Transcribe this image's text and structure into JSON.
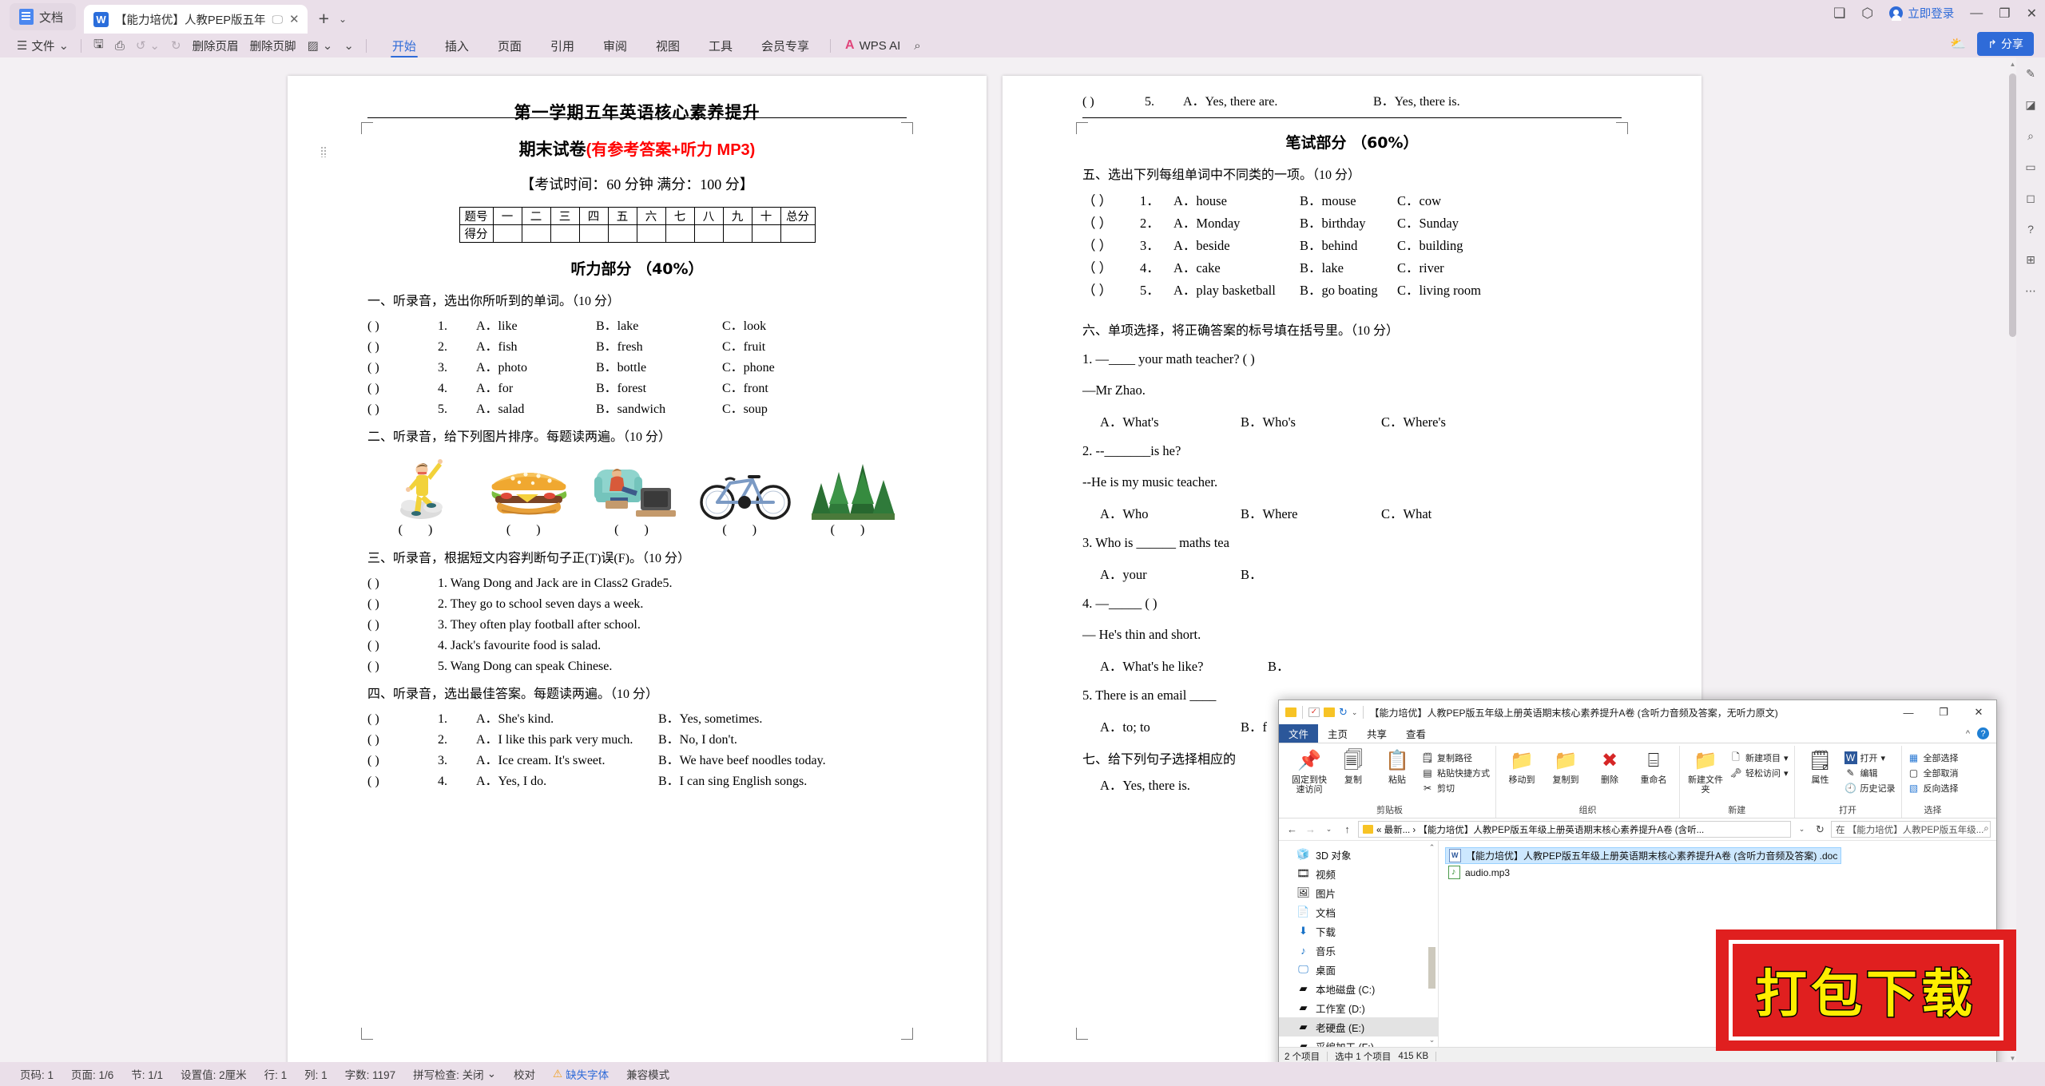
{
  "window": {
    "doc_chip_label": "文档",
    "tab_label": "【能力培优】人教PEP版五年",
    "tab_close": "✕",
    "add_tab": "+",
    "tab_caret": "⌄",
    "login_label": "立即登录",
    "minimize": "—",
    "maximize": "❐",
    "close": "✕",
    "icon_a": "❏",
    "icon_b": "⬡",
    "share_label": "分享",
    "cloud_icon": "cloud-upload-icon"
  },
  "toolbar": {
    "file_menu": "文件",
    "file_caret": "⌄",
    "quick": [
      {
        "icon": "save-icon",
        "glyph": "🖫"
      },
      {
        "icon": "print-icon",
        "glyph": "⎙"
      },
      {
        "icon": "undo-icon",
        "glyph": "↺"
      },
      {
        "icon": "undo-caret",
        "glyph": "⌄"
      },
      {
        "icon": "redo-icon",
        "glyph": "↻"
      }
    ],
    "del_header": "删除页眉",
    "del_footer": "删除页脚",
    "style_caret": "⌄",
    "more_caret": "⌄",
    "menus": [
      {
        "label": "开始",
        "active": true
      },
      {
        "label": "插入",
        "active": false
      },
      {
        "label": "页面",
        "active": false
      },
      {
        "label": "引用",
        "active": false
      },
      {
        "label": "审阅",
        "active": false
      },
      {
        "label": "视图",
        "active": false
      },
      {
        "label": "工具",
        "active": false
      },
      {
        "label": "会员专享",
        "active": false
      }
    ],
    "wps_ai": "WPS AI",
    "search_icon": "search-icon"
  },
  "document": {
    "title1": "第一学期五年英语核心素养提升",
    "title2_black": "期末试卷",
    "title2_red": "(有参考答案+听力 MP3)",
    "title3": "【考试时间：60 分钟 满分：100 分】",
    "score_table": {
      "row1_label": "题号",
      "row1_cells": [
        "一",
        "二",
        "三",
        "四",
        "五",
        "六",
        "七",
        "八",
        "九",
        "十"
      ],
      "row1_total": "总分",
      "row2_label": "得分"
    },
    "listening_section": "听力部分 （40%）",
    "q1": {
      "head": "一、听录音，选出你所听到的单词。（10 分）",
      "rows": [
        {
          "paren": "(            )",
          "num": "1.",
          "a": "A．like",
          "b": "B．lake",
          "c": "C．look"
        },
        {
          "paren": "(            )",
          "num": "2.",
          "a": "A．fish",
          "b": "B．fresh",
          "c": "C．fruit"
        },
        {
          "paren": "(            )",
          "num": "3.",
          "a": "A．photo",
          "b": "B．bottle",
          "c": "C．phone"
        },
        {
          "paren": "(            )",
          "num": "4.",
          "a": "A．for",
          "b": "B．forest",
          "c": "C．front"
        },
        {
          "paren": "(            )",
          "num": "5.",
          "a": "A．salad",
          "b": "B．sandwich",
          "c": "C．soup"
        }
      ]
    },
    "q2": {
      "head": "二、听录音，给下列图片排序。每题读两遍。（10 分）",
      "pictures": [
        "kungfu-boy-image",
        "hamburger-image",
        "watching-tv-image",
        "bicycle-image",
        "forest-image"
      ],
      "answer_blanks": [
        "(        )",
        "(        )",
        "(        )",
        "(        )",
        "(        )"
      ]
    },
    "q3": {
      "head": "三、听录音，根据短文内容判断句子正(T)误(F)。（10 分）",
      "rows": [
        {
          "paren": "(            )",
          "text": "1. Wang Dong and Jack are in Class2 Grade5."
        },
        {
          "paren": "(            )",
          "text": "2. They go to school seven days a week."
        },
        {
          "paren": "(            )",
          "text": "3. They often play football after school."
        },
        {
          "paren": "(            )",
          "text": "4. Jack's favourite food is salad."
        },
        {
          "paren": "(            )",
          "text": "5. Wang Dong can speak Chinese."
        }
      ]
    },
    "q4": {
      "head": "四、听录音，选出最佳答案。每题读两遍。（10 分）",
      "rows": [
        {
          "paren": "(        )",
          "num": "1.",
          "a": "A．She's kind.",
          "b": "B．Yes, sometimes."
        },
        {
          "paren": "(        )",
          "num": "2.",
          "a": "A．I like this park very much.",
          "b": "B．No, I don't."
        },
        {
          "paren": "(        )",
          "num": "3.",
          "a": "A．Ice cream. It's sweet.",
          "b": "B．We have beef noodles today."
        },
        {
          "paren": "(        )",
          "num": "4.",
          "a": "A．Yes, I do.",
          "b": "B．I can sing English songs."
        }
      ]
    }
  },
  "document_right": {
    "q4_last": {
      "paren": "(        )",
      "num": "5.",
      "a": "A．Yes, there are.",
      "b": "B．Yes, there is."
    },
    "written_section": "笔试部分 （60%）",
    "q5": {
      "head": "五、选出下列每组单词中不同类的一项。（10 分）",
      "rows": [
        {
          "paren": "（      ）",
          "num": "1．",
          "a": "A．house",
          "b": "B．mouse",
          "c": "C．cow"
        },
        {
          "paren": "（      ）",
          "num": "2．",
          "a": "A．Monday",
          "b": "B．birthday",
          "c": "C．Sunday"
        },
        {
          "paren": "（      ）",
          "num": "3．",
          "a": "A．beside",
          "b": "B．behind",
          "c": "C．building"
        },
        {
          "paren": "（      ）",
          "num": "4．",
          "a": "A．cake",
          "b": "B．lake",
          "c": "C．river"
        },
        {
          "paren": "（      ）",
          "num": "5．",
          "a": "A．play basketball",
          "b": "B．go boating",
          "c": "C．living room"
        }
      ]
    },
    "q6": {
      "head": "六、单项选择，将正确答案的标号填在括号里。（10 分）",
      "item1_q": "1.    —____ your math teacher? (      )",
      "item1_ans": "—Mr Zhao.",
      "item1_opts": [
        "A．What's",
        "B．Who's",
        "C．Where's"
      ],
      "item2_q": "2.    --_______is he?",
      "item2_ans": "--He is my music teacher.",
      "item2_opts": [
        "A．Who",
        "B．Where",
        "C．What"
      ],
      "item3_q": "3.    Who is ______ maths tea",
      "item3_opts": [
        "A．your",
        "B．"
      ],
      "item4_q": "4.    —_____     (      )",
      "item4_ans": "— He's thin and short.",
      "item4_opts": [
        "A．What's he like?",
        "B．"
      ],
      "item5_q": "5.    There is an email ____",
      "item5_opts": [
        "A．to; to",
        "B．f"
      ]
    },
    "q7": {
      "head": "七、给下列句子选择相应的",
      "opt": "A．Yes, there is."
    }
  },
  "statusbar": {
    "items": [
      {
        "label": "页码: 1"
      },
      {
        "label": "页面: 1/6"
      },
      {
        "label": "节: 1/1"
      },
      {
        "label": "设置值: 2厘米"
      },
      {
        "label": "行: 1"
      },
      {
        "label": "列: 1"
      },
      {
        "label": "字数: 1197"
      },
      {
        "label": "拼写检查: 关闭",
        "caret": "⌄"
      },
      {
        "label": "校对"
      },
      {
        "label": "缺失字体",
        "warn": true
      },
      {
        "label": "兼容模式"
      }
    ]
  },
  "rail": {
    "icons": [
      "pen-icon",
      "shapes-icon",
      "cursor-icon",
      "comment-icon",
      "layers-icon",
      "help-icon",
      "grid-icon",
      "more-icon"
    ],
    "glyphs": [
      "✎",
      "◪",
      "⌕",
      "▭",
      "◻",
      "?",
      "⊞",
      "⋯"
    ]
  },
  "explorer": {
    "title": "【能力培优】人教PEP版五年级上册英语期末核心素养提升A卷 (含听力音频及答案，无听力原文)",
    "qat_caret": "⌄",
    "undo_glyph": "↻",
    "minimize": "—",
    "maximize": "❐",
    "close": "✕",
    "tabs": [
      {
        "label": "文件",
        "kind": "file"
      },
      {
        "label": "主页",
        "kind": "normal"
      },
      {
        "label": "共享",
        "kind": "normal"
      },
      {
        "label": "查看",
        "kind": "normal"
      }
    ],
    "help_caret": "^",
    "help_q": "?",
    "ribbon": [
      {
        "name": "剪贴板",
        "big": [
          {
            "label": "固定到快速访问",
            "glyph": "📌"
          },
          {
            "label": "复制",
            "glyph": "🗐"
          },
          {
            "label": "粘贴",
            "glyph": "📋"
          }
        ],
        "small": [
          {
            "label": "复制路径",
            "glyph": "⿻"
          },
          {
            "label": "粘贴快捷方式",
            "glyph": "▤"
          },
          {
            "label": "剪切",
            "glyph": "✂"
          }
        ]
      },
      {
        "name": "组织",
        "big": [
          {
            "label": "移动到",
            "glyph": "📁"
          },
          {
            "label": "复制到",
            "glyph": "📁"
          },
          {
            "label": "删除",
            "glyph": "✖"
          },
          {
            "label": "重命名",
            "glyph": "⌸"
          }
        ],
        "small": []
      },
      {
        "name": "新建",
        "big": [
          {
            "label": "新建文件夹",
            "glyph": "📁"
          }
        ],
        "small": [
          {
            "label": "新建项目",
            "glyph": "🗋"
          },
          {
            "label": "轻松访问",
            "glyph": "🗝"
          }
        ]
      },
      {
        "name": "打开",
        "big": [
          {
            "label": "属性",
            "glyph": "🗒"
          }
        ],
        "small": [
          {
            "label": "打开",
            "glyph": "W"
          },
          {
            "label": "编辑",
            "glyph": "✎"
          },
          {
            "label": "历史记录",
            "glyph": "🕘"
          }
        ]
      },
      {
        "name": "选择",
        "big": [],
        "small": [
          {
            "label": "全部选择",
            "glyph": "▦"
          },
          {
            "label": "全部取消",
            "glyph": "▢"
          },
          {
            "label": "反向选择",
            "glyph": "▧"
          }
        ]
      }
    ],
    "address": {
      "back": "←",
      "forward": "→",
      "recent": "⌄",
      "up": "↑",
      "crumb": "« 最新... ›  【能力培优】人教PEP版五年级上册英语期末核心素养提升A卷 (含听...",
      "crumb_caret": "⌄",
      "refresh": "↻",
      "search_placeholder": "在 【能力培优】人教PEP版五年级...",
      "search_icon": "search-icon"
    },
    "nav_items": [
      {
        "label": "3D 对象",
        "icon": "cube-icon",
        "glyph": "🧊",
        "selected": false
      },
      {
        "label": "视频",
        "icon": "video-icon",
        "glyph": "🎞",
        "selected": false
      },
      {
        "label": "图片",
        "icon": "picture-icon",
        "glyph": "🖼",
        "selected": false
      },
      {
        "label": "文档",
        "icon": "document-icon",
        "glyph": "📄",
        "selected": false
      },
      {
        "label": "下载",
        "icon": "download-icon",
        "glyph": "⬇",
        "selected": false
      },
      {
        "label": "音乐",
        "icon": "music-icon",
        "glyph": "♪",
        "selected": false
      },
      {
        "label": "桌面",
        "icon": "desktop-icon",
        "glyph": "🖵",
        "selected": false
      },
      {
        "label": "本地磁盘 (C:)",
        "icon": "drive-icon",
        "glyph": "▰",
        "selected": false
      },
      {
        "label": "工作室 (D:)",
        "icon": "drive-icon",
        "glyph": "▰",
        "selected": false
      },
      {
        "label": "老硬盘 (E:)",
        "icon": "drive-icon",
        "glyph": "▰",
        "selected": true
      },
      {
        "label": "采编加工 (F:)",
        "icon": "drive-icon",
        "glyph": "▰",
        "selected": false
      }
    ],
    "files": [
      {
        "name": "【能力培优】人教PEP版五年级上册英语期末核心素养提升A卷 (含听力音频及答案) .doc",
        "type": "doc",
        "selected": true
      },
      {
        "name": "audio.mp3",
        "type": "mp3",
        "selected": false
      }
    ],
    "status": {
      "count": "2 个项目",
      "selected": "选中 1 个项目",
      "size": "415 KB"
    }
  },
  "stamp": {
    "text": "打包下载"
  }
}
